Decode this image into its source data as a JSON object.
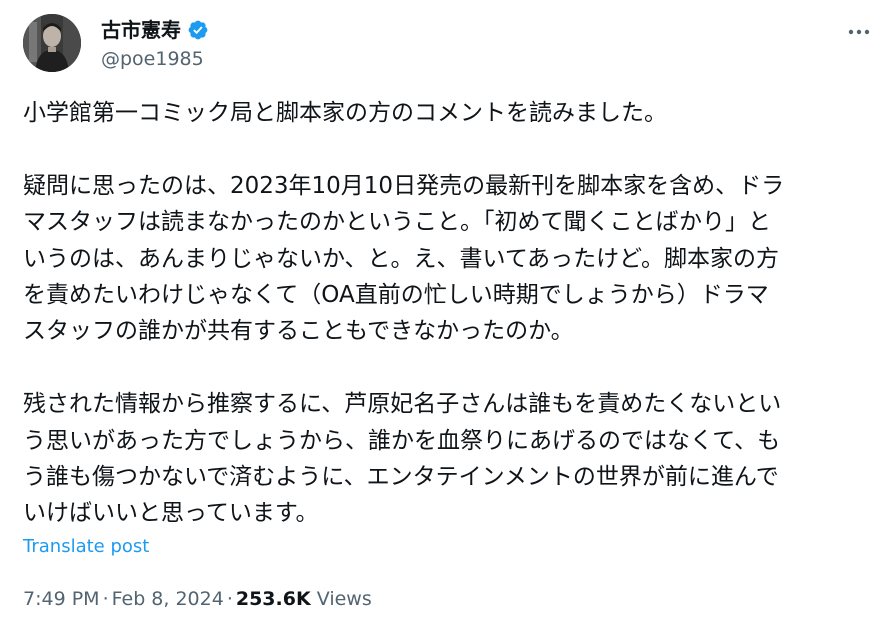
{
  "author": {
    "display_name": "古市憲寿",
    "handle": "@poe1985",
    "verified": true
  },
  "icons": {
    "verified": "verified-badge-icon",
    "more": "more-options-icon",
    "avatar": "profile-photo"
  },
  "colors": {
    "accent": "#1d9bf0",
    "text": "#0f1419",
    "muted": "#536471"
  },
  "post": {
    "paragraphs": [
      {
        "lines": [
          "小学館第一コミック局と脚本家の方のコメントを読みました。"
        ]
      },
      {
        "lines": [
          "疑問に思ったのは、2023年10月10日発売の最新刊を脚本家を含め、ドラ",
          "マスタッフは読まなかったのかということ。「初めて聞くことばかり」と",
          "いうのは、あんまりじゃないか、と。え、書いてあったけど。脚本家の方",
          "を責めたいわけじゃなくて（OA直前の忙しい時期でしょうから）ドラマ",
          "スタッフの誰かが共有することもできなかったのか。"
        ]
      },
      {
        "lines": [
          "残された情報から推察するに、芦原妃名子さんは誰もを責めたくないとい",
          "う思いがあった方でしょうから、誰かを血祭りにあげるのではなくて、も",
          "う誰も傷つかないで済むように、エンタテインメントの世界が前に進んで",
          "いけばいいと思っています。"
        ]
      }
    ],
    "translate_label": "Translate post"
  },
  "meta": {
    "time": "7:49 PM",
    "separator": "·",
    "date": "Feb 8, 2024",
    "views_count": "253.6K",
    "views_label": "Views"
  }
}
